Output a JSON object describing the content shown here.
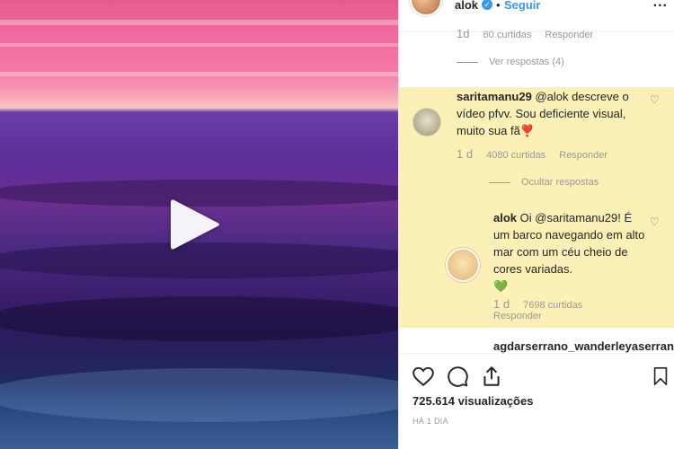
{
  "header": {
    "username": "alok",
    "follow_label": "Seguir",
    "separator": "•",
    "more": "..."
  },
  "previous_comment_meta": {
    "time": "1d",
    "likes": "60 curtidas",
    "reply": "Responder"
  },
  "view_replies": "Ver respostas (4)",
  "comment": {
    "username": "saritamanu29",
    "text": "@alok descreve o vídeo pfvv. Sou deficiente visual, muito sua fã",
    "emoji": "❣️",
    "time": "1 d",
    "likes": "4080 curtidas",
    "reply": "Responder",
    "hide_replies": "Ocultar respostas"
  },
  "reply": {
    "username": "alok",
    "text": "Oi @saritamanu29! É um barco navegando em alto mar com um céu cheio de cores variadas.",
    "emoji": "💚",
    "time": "1 d",
    "likes": "7698 curtidas",
    "reply": "Responder"
  },
  "next_comment_username": "agdarserrano_wanderleyaserrano",
  "stats": {
    "views": "725.614 visualizações",
    "posted": "HÁ 1 DIA"
  },
  "icons": [
    "play-icon",
    "verified-icon",
    "heart-icon",
    "comment-icon",
    "share-icon",
    "bookmark-icon"
  ],
  "colors": {
    "highlight": "#fbf0b6",
    "link": "#3897f0",
    "muted": "#999999"
  }
}
